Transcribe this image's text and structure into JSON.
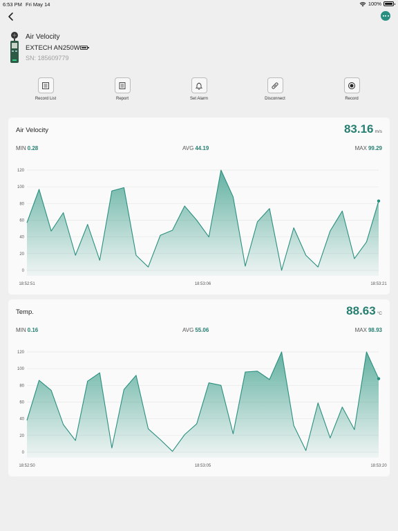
{
  "status_bar": {
    "time": "6:53 PM",
    "date": "Fri May 14",
    "battery_percent": "100%"
  },
  "device": {
    "name": "Air Velocity",
    "model": "EXTECH AN250W",
    "serial": "SN: 185609779",
    "battery_level": 1.0
  },
  "actions": [
    {
      "label": "Record List",
      "icon": "list-icon"
    },
    {
      "label": "Report",
      "icon": "report-icon"
    },
    {
      "label": "Set Alarm",
      "icon": "bell-icon"
    },
    {
      "label": "Disconnect",
      "icon": "disconnect-icon"
    },
    {
      "label": "Record",
      "icon": "record-icon"
    }
  ],
  "colors": {
    "accent": "#267f70",
    "line": "#2a8f7f",
    "fill": "#4aa593"
  },
  "cards": [
    {
      "title": "Air Velocity",
      "current": "83.16",
      "unit": "m/s",
      "min_label": "MIN",
      "min": "0.28",
      "avg_label": "AVG",
      "avg": "44.19",
      "max_label": "MAX",
      "max": "99.29"
    },
    {
      "title": "Temp.",
      "current": "88.63",
      "unit": "°C",
      "min_label": "MIN",
      "min": "0.16",
      "avg_label": "AVG",
      "avg": "55.06",
      "max_label": "MAX",
      "max": "98.93"
    }
  ],
  "chart_data": [
    {
      "type": "area",
      "title": "",
      "xlabel": "",
      "ylabel": "",
      "ylim": [
        0,
        120
      ],
      "yticks": [
        "0",
        "20",
        "40",
        "60",
        "80",
        "100",
        "120"
      ],
      "x_tick_labels": [
        "18:52:51",
        "18:53:06",
        "18:53:21"
      ],
      "grid": true,
      "legend": "none",
      "values": [
        57,
        97,
        47,
        69,
        18,
        55,
        12,
        95,
        99,
        18,
        4,
        42,
        48,
        77,
        60,
        40,
        120,
        88,
        5,
        58,
        74,
        0,
        51,
        18,
        4,
        47,
        71,
        14,
        34,
        83
      ]
    },
    {
      "type": "area",
      "title": "",
      "xlabel": "",
      "ylabel": "",
      "ylim": [
        0,
        120
      ],
      "yticks": [
        "0",
        "20",
        "40",
        "60",
        "80",
        "100",
        "120"
      ],
      "x_tick_labels": [
        "18:52:50",
        "18:53:05",
        "18:53:20"
      ],
      "grid": true,
      "legend": "none",
      "values": [
        38,
        86,
        74,
        33,
        14,
        85,
        95,
        5,
        75,
        92,
        28,
        15,
        1,
        21,
        34,
        83,
        80,
        22,
        96,
        97,
        87,
        120,
        32,
        2,
        59,
        17,
        54,
        27,
        120,
        88
      ]
    }
  ]
}
